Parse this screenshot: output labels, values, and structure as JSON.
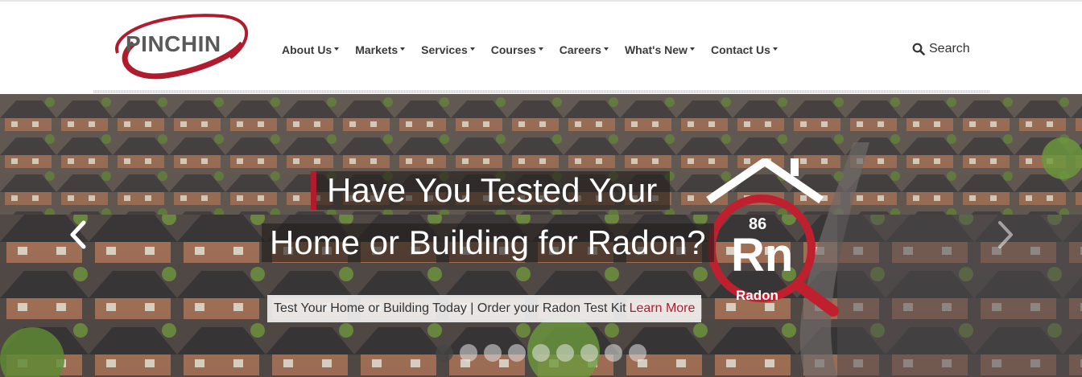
{
  "brand": {
    "logo_text": "PINCHIN",
    "accent": "#b01c2e"
  },
  "nav": [
    {
      "label": "About Us"
    },
    {
      "label": "Markets"
    },
    {
      "label": "Services"
    },
    {
      "label": "Courses"
    },
    {
      "label": "Careers"
    },
    {
      "label": "What's New"
    },
    {
      "label": "Contact Us"
    }
  ],
  "search": {
    "label": "Search",
    "icon": "search-icon"
  },
  "hero": {
    "headline_line1": "Have You Tested Your",
    "headline_line2": "Home or Building for Radon?",
    "cta_text": "Test Your Home or Building Today | Order your Radon Test Kit",
    "cta_link": "Learn More",
    "badge": {
      "number": "86",
      "symbol": "Rn",
      "name": "Radon"
    },
    "slide_count": 9,
    "active_slide": 1
  }
}
